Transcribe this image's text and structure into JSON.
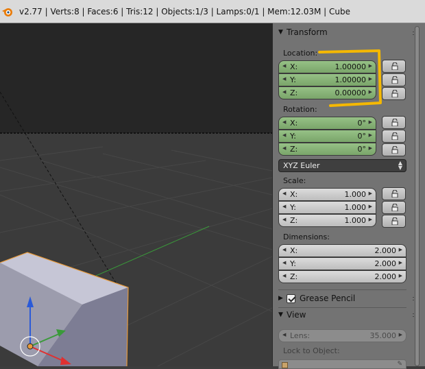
{
  "header": {
    "info": "v2.77 | Verts:8 | Faces:6 | Tris:12 | Objects:1/3 | Lamps:0/1 | Mem:12.03M | Cube"
  },
  "transform": {
    "title": "Transform",
    "location_label": "Location:",
    "location": [
      {
        "axis": "X:",
        "value": "1.00000"
      },
      {
        "axis": "Y:",
        "value": "1.00000"
      },
      {
        "axis": "Z:",
        "value": "0.00000"
      }
    ],
    "rotation_label": "Rotation:",
    "rotation": [
      {
        "axis": "X:",
        "value": "0°"
      },
      {
        "axis": "Y:",
        "value": "0°"
      },
      {
        "axis": "Z:",
        "value": "0°"
      }
    ],
    "rotation_mode": "XYZ Euler",
    "scale_label": "Scale:",
    "scale": [
      {
        "axis": "X:",
        "value": "1.000"
      },
      {
        "axis": "Y:",
        "value": "1.000"
      },
      {
        "axis": "Z:",
        "value": "1.000"
      }
    ],
    "dimensions_label": "Dimensions:",
    "dimensions": [
      {
        "axis": "X:",
        "value": "2.000"
      },
      {
        "axis": "Y:",
        "value": "2.000"
      },
      {
        "axis": "Z:",
        "value": "2.000"
      }
    ]
  },
  "grease_pencil": {
    "title": "Grease Pencil"
  },
  "view": {
    "title": "View",
    "lens_label": "Lens:",
    "lens_value": "35.000",
    "lock_to_object_label": "Lock to Object:"
  },
  "colors": {
    "highlight": "#f5b800",
    "selection_outline": "#e89a3a",
    "x_axis": "#e03030",
    "y_axis": "#3a9a3a",
    "z_axis": "#2a5ad8"
  },
  "icons": [
    "blender-logo-icon",
    "lock-icon",
    "eyedropper-icon",
    "cube-icon"
  ]
}
